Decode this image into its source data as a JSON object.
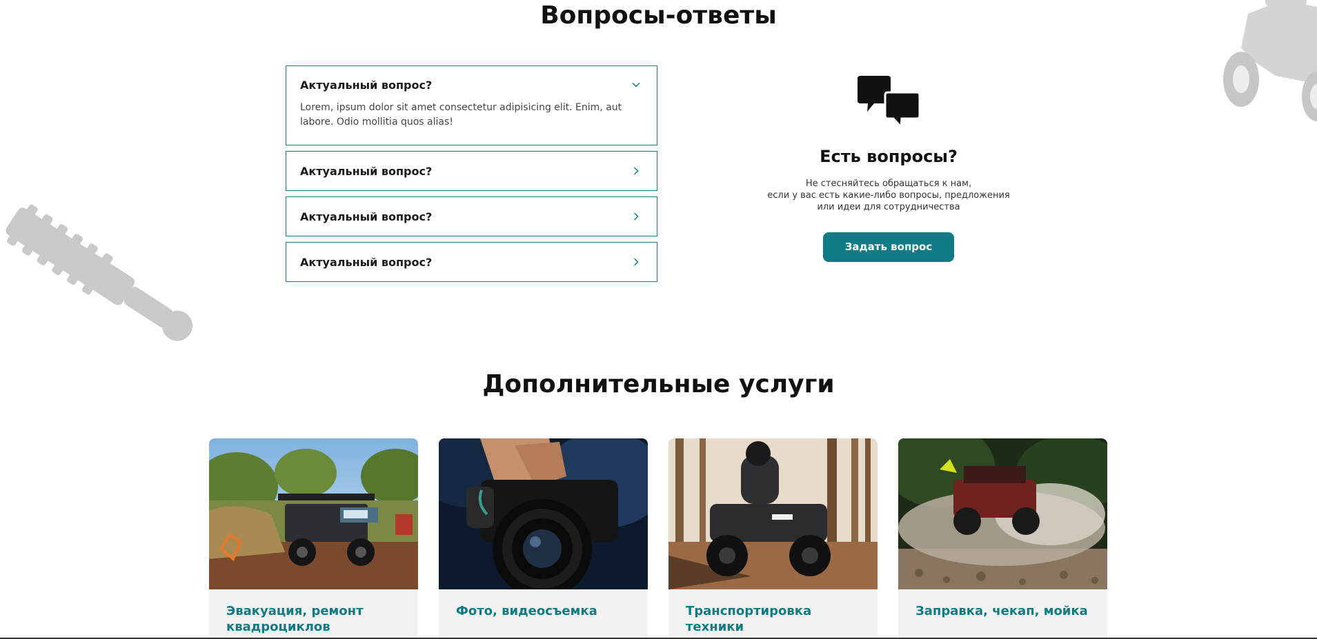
{
  "faq": {
    "title": "Вопросы-ответы",
    "items": [
      {
        "question": "Актуальный вопрос?",
        "answer": "Lorem, ipsum dolor sit amet consectetur adipisicing elit. Enim, aut labore. Odio mollitia quos alias!",
        "expanded": true
      },
      {
        "question": "Актуальный вопрос?",
        "expanded": false
      },
      {
        "question": "Актуальный вопрос?",
        "expanded": false
      },
      {
        "question": "Актуальный вопрос?",
        "expanded": false
      }
    ]
  },
  "contact": {
    "icon": "chat-bubbles-icon",
    "title": "Есть вопросы?",
    "text_lines": [
      "Не стесняйтесь обращаться к нам,",
      "если у вас есть какие-либо вопросы, предложения",
      "или идеи для сотрудничества"
    ],
    "button_label": "Задать вопрос"
  },
  "services": {
    "title": "Дополнительные услуги",
    "cards": [
      {
        "label": "Эвакуация, ремонт квадроциклов",
        "image": "utility-vehicle-photo"
      },
      {
        "label": "Фото, видеосъемка",
        "image": "camera-photo"
      },
      {
        "label": "Транспортировка техники",
        "image": "atv-rider-photo"
      },
      {
        "label": "Заправка, чекап, мойка",
        "image": "buggy-splash-photo"
      }
    ]
  },
  "colors": {
    "accent": "#0f7b86",
    "border": "#127f8a",
    "card_bg": "#f2f2f2"
  }
}
